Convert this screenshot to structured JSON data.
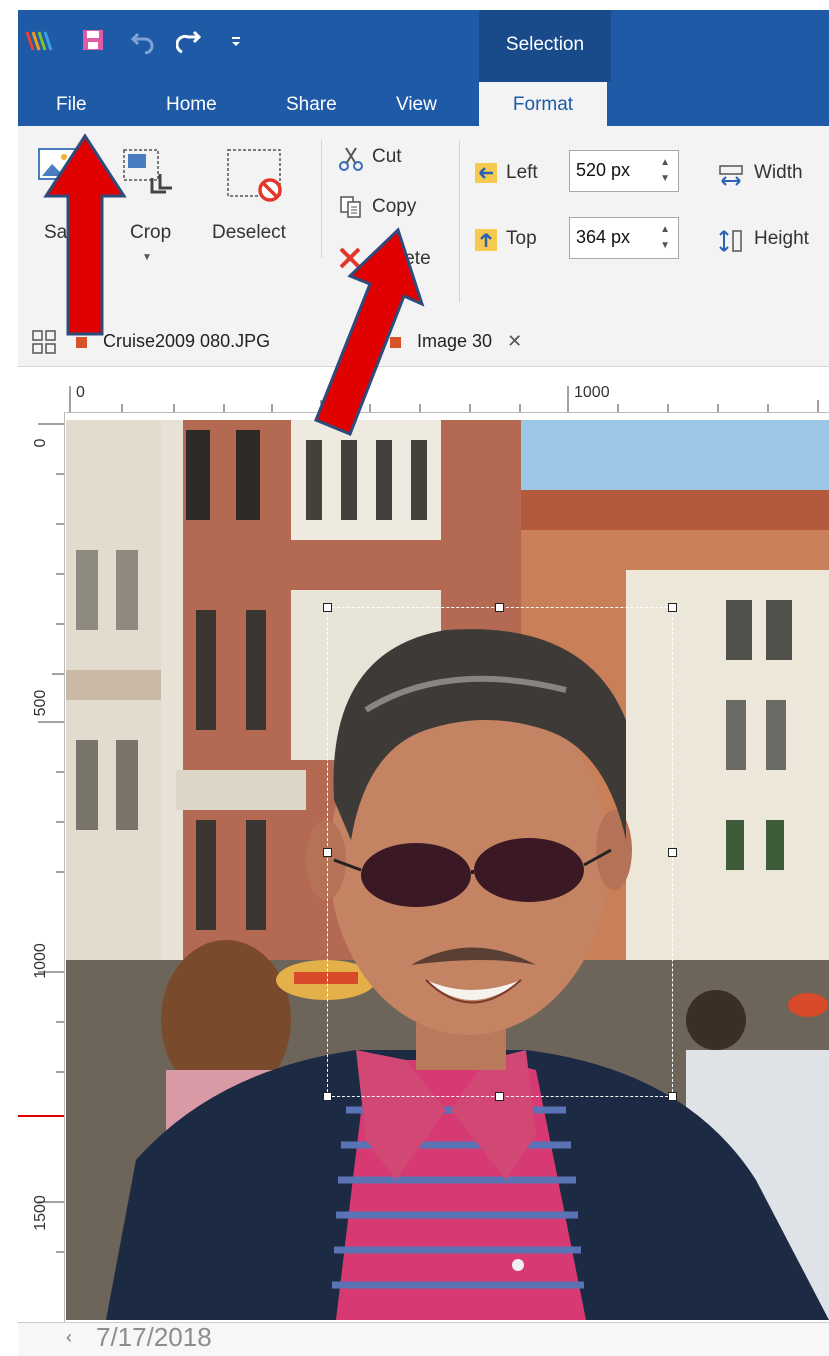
{
  "titlebar": {
    "context_group": "Selection",
    "accent_color": "#1f5aa6"
  },
  "tabs": [
    "File",
    "Home",
    "Share",
    "View",
    "Format"
  ],
  "ribbon": {
    "save_label": "Sa",
    "crop_label": "Crop",
    "deselect_label": "Deselect",
    "cut_label": "Cut",
    "copy_label": "Copy",
    "delete_label": "lete",
    "left_label": "Left",
    "left_value": "520 px",
    "top_label": "Top",
    "top_value": "364 px",
    "width_label": "Width",
    "height_label": "Height"
  },
  "documents": [
    {
      "name": "Cruise2009 080.JPG"
    },
    {
      "name": "Image 30"
    }
  ],
  "ruler": {
    "h_labels": [
      "0",
      "1000"
    ],
    "v_labels": [
      "0",
      "500",
      "1000",
      "1500"
    ]
  },
  "footer": {
    "date": "7/17/2018"
  },
  "icons": [
    "app-logo-icon",
    "save-icon",
    "undo-icon",
    "redo-icon",
    "qat-dropdown-icon",
    "image-icon",
    "crop-icon",
    "deselect-icon",
    "cut-icon",
    "copy-icon",
    "delete-icon",
    "left-position-icon",
    "top-position-icon",
    "width-icon",
    "height-icon",
    "grid-view-icon",
    "close-icon",
    "scroll-left-icon"
  ],
  "annotation_color": "#e00000"
}
